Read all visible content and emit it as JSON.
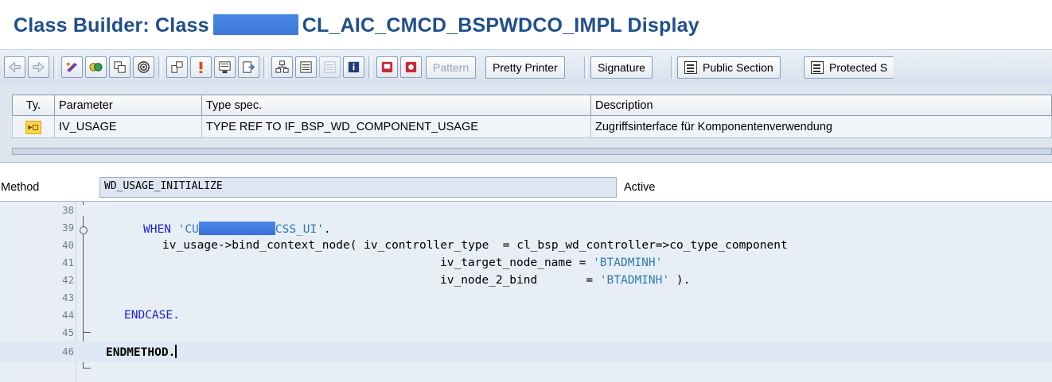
{
  "title": {
    "prefix": "Class Builder: Class",
    "suffix": "CL_AIC_CMCD_BSPWDCO_IMPL Display"
  },
  "toolbar": {
    "icons": [
      "back-icon",
      "forward-icon",
      "other-object-icon",
      "check-icon",
      "activate-icon",
      "where-used-icon",
      "display-object-list-icon",
      "navigation-window-icon",
      "info-icon",
      "enhance-icon",
      "object-tree-icon",
      "help-icon",
      "layout-icon",
      "info-window-icon",
      "breakpoint-icon",
      "external-breakpoint-icon"
    ],
    "pattern_label": "Pattern",
    "pretty_printer_label": "Pretty Printer",
    "signature_label": "Signature",
    "public_section_label": "Public Section",
    "protected_section_label": "Protected S"
  },
  "params": {
    "headers": [
      "Ty.",
      "Parameter",
      "Type spec.",
      "Description"
    ],
    "rows": [
      {
        "type_icon": "importing-icon",
        "parameter": "IV_USAGE",
        "type_spec": "TYPE REF TO IF_BSP_WD_COMPONENT_USAGE",
        "description": "Zugriffsinterface für Komponentenverwendung"
      }
    ]
  },
  "method": {
    "label": "Method",
    "name": "WD_USAGE_INITIALIZE",
    "status": "Active"
  },
  "code": {
    "lines": [
      {
        "no": "38",
        "text": ""
      },
      {
        "no": "39",
        "kw": "WHEN",
        "s1": "'CU",
        "s2": "CSS_UI'",
        "tail": "."
      },
      {
        "no": "40",
        "text": "iv_usage->bind_context_node( iv_controller_type  = cl_bsp_wd_controller=>co_type_component"
      },
      {
        "no": "41",
        "pre": "iv_target_node_name = ",
        "str": "'BTADMINH'"
      },
      {
        "no": "42",
        "pre": "iv_node_2_bind       = ",
        "str": "'BTADMINH'",
        "tail": " )."
      },
      {
        "no": "43",
        "text": ""
      },
      {
        "no": "44",
        "kw": "ENDCASE."
      },
      {
        "no": "45",
        "text": ""
      },
      {
        "no": "46",
        "kw": "ENDMETHOD."
      }
    ]
  },
  "colors": {
    "title": "#1f4e8c",
    "keyword": "#1a24c8",
    "string": "#2e7bb0",
    "mask": "#4a86e8"
  }
}
